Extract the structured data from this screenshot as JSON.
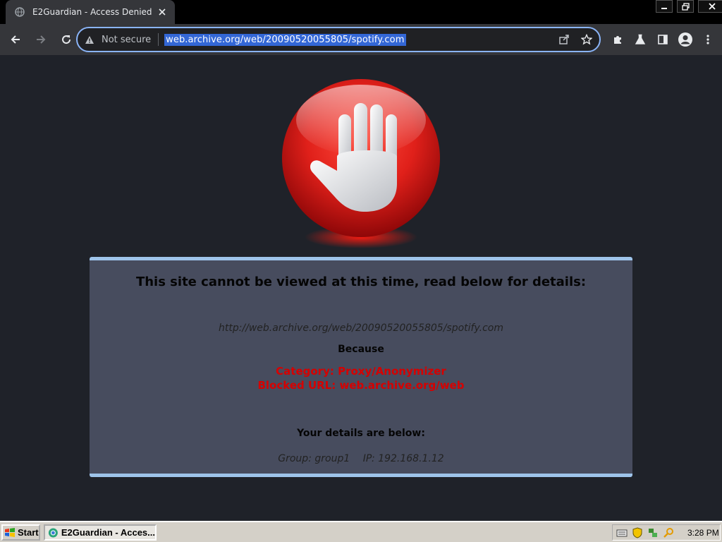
{
  "browser": {
    "tab_title": "E2Guardian - Access Denied",
    "security_label": "Not secure",
    "url": "web.archive.org/web/20090520055805/spotify.com",
    "accent_color": "#8ab4f8"
  },
  "page": {
    "headline": "This site cannot be viewed at this time, read below for details:",
    "blocked_url": "http://web.archive.org/web/20090520055805/spotify.com",
    "because_label": "Because",
    "reason_category": "Category: Proxy/Anonymizer",
    "reason_blocked_url": "Blocked URL: web.archive.org/web",
    "details_heading": "Your details are below:",
    "group": "Group: group1",
    "ip": "IP: 192.168.1.12",
    "reason_color": "#d60000"
  },
  "taskbar": {
    "start_label": "Start",
    "task_label": "E2Guardian - Acces...",
    "clock": "3:28 PM"
  }
}
